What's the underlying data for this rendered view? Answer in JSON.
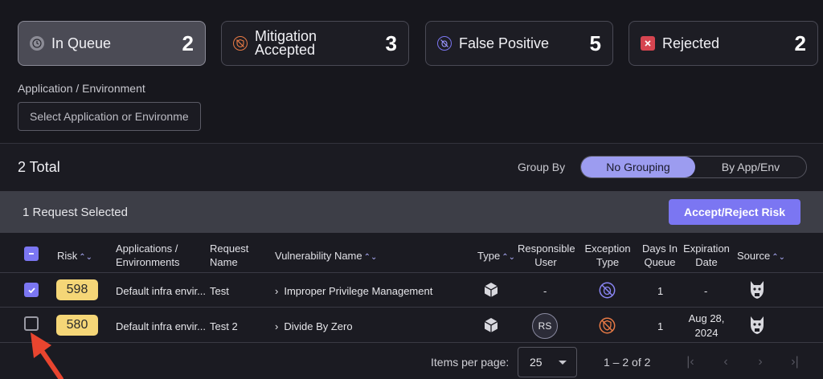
{
  "status_cards": [
    {
      "label": "In Queue",
      "count": "2",
      "icon": "clock-icon",
      "icon_color": "#8c8c96",
      "active": true
    },
    {
      "label_line1": "Mitigation",
      "label_line2": "Accepted",
      "count": "3",
      "icon": "shield-slash-icon",
      "icon_color": "#e87a45"
    },
    {
      "label": "False Positive",
      "count": "5",
      "icon": "bug-slash-icon",
      "icon_color": "#7b76f2"
    },
    {
      "label": "Rejected",
      "count": "2",
      "icon": "x-square-icon",
      "icon_color": "#d64550"
    }
  ],
  "filter": {
    "label": "Application / Environment",
    "placeholder": "Select Application or Environment"
  },
  "summary": {
    "total": "2 Total",
    "group_by_label": "Group By",
    "group_options": [
      "No Grouping",
      "By App/Env"
    ],
    "selected_group": "No Grouping"
  },
  "selection_bar": {
    "text": "1 Request Selected",
    "action_label": "Accept/Reject Risk"
  },
  "table": {
    "headers": {
      "risk": "Risk",
      "apps_line1": "Applications /",
      "apps_line2": "Environments",
      "request_line1": "Request",
      "request_line2": "Name",
      "vuln": "Vulnerability Name",
      "type": "Type",
      "responsible_line1": "Responsible",
      "responsible_line2": "User",
      "exception_line1": "Exception",
      "exception_line2": "Type",
      "days_line1": "Days In",
      "days_line2": "Queue",
      "expiration_line1": "Expiration",
      "expiration_line2": "Date",
      "source": "Source"
    },
    "rows": [
      {
        "checked": true,
        "risk": "598",
        "app": "Default infra envir...",
        "request": "Test",
        "vuln": "Improper Privilege Management",
        "type_icon": "cube-icon",
        "responsible": "-",
        "exception_icon": "bug-slash-icon",
        "days": "1",
        "expiration": "-",
        "source_icon": "mascot-icon"
      },
      {
        "checked": false,
        "risk": "580",
        "app": "Default infra envir...",
        "request": "Test 2",
        "vuln": "Divide By Zero",
        "type_icon": "cube-icon",
        "responsible": "RS",
        "exception_icon": "shield-slash-icon",
        "days": "1",
        "expiration_line1": "Aug 28,",
        "expiration_line2": "2024",
        "source_icon": "mascot-icon"
      }
    ]
  },
  "pagination": {
    "items_per_page_label": "Items per page:",
    "items_per_page": "25",
    "range": "1 – 2 of 2"
  },
  "colors": {
    "accent": "#7b76f2",
    "risk_badge": "#f5d677",
    "annotation_arrow": "#e8452f"
  }
}
